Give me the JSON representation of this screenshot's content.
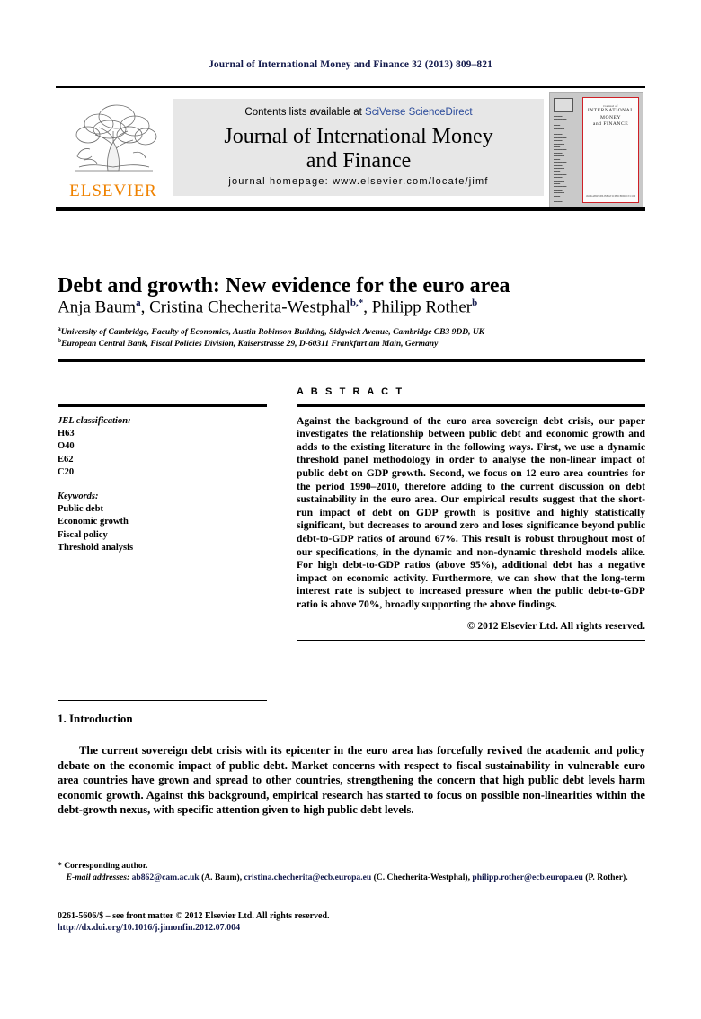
{
  "running_head": "Journal of International Money and Finance 32 (2013) 809–821",
  "masthead": {
    "contents_prefix": "Contents lists available at ",
    "sciencedirect": "SciVerse ScienceDirect",
    "journal_name_line1": "Journal of International Money",
    "journal_name_line2": "and Finance",
    "homepage": "journal homepage: www.elsevier.com/locate/jimf",
    "publisher_wordmark": "ELSEVIER",
    "publisher_color": "#ef8200",
    "band_background": "#e7e7e7"
  },
  "cover": {
    "line_small": "Journal of",
    "line1": "INTERNATIONAL",
    "line2": "MONEY",
    "line3": "and FINANCE",
    "footer": "AVAILABLE ONLINE AT SCIENCEDIRECT.COM",
    "border_color": "#cf2027",
    "background": "#c9c9c9"
  },
  "article": {
    "title": "Debt and growth: New evidence for the euro area",
    "authors": [
      {
        "name": "Anja Baum",
        "marks": "a"
      },
      {
        "name": "Cristina Checherita-Westphal",
        "marks": "b,*"
      },
      {
        "name": "Philipp Rother",
        "marks": "b"
      }
    ],
    "affiliations": [
      {
        "mark": "a",
        "text": "University of Cambridge, Faculty of Economics, Austin Robinson Building, Sidgwick Avenue, Cambridge CB3 9DD, UK"
      },
      {
        "mark": "b",
        "text": "European Central Bank, Fiscal Policies Division, Kaiserstrasse 29, D-60311 Frankfurt am Main, Germany"
      }
    ]
  },
  "info": {
    "jel_label": "JEL classification:",
    "jel_codes": [
      "H63",
      "O40",
      "E62",
      "C20"
    ],
    "keywords_label": "Keywords:",
    "keywords": [
      "Public debt",
      "Economic growth",
      "Fiscal policy",
      "Threshold analysis"
    ]
  },
  "abstract": {
    "heading": "A B S T R A C T",
    "text": "Against the background of the euro area sovereign debt crisis, our paper investigates the relationship between public debt and economic growth and adds to the existing literature in the following ways. First, we use a dynamic threshold panel methodology in order to analyse the non-linear impact of public debt on GDP growth. Second, we focus on 12 euro area countries for the period 1990–2010, therefore adding to the current discussion on debt sustainability in the euro area. Our empirical results suggest that the short-run impact of debt on GDP growth is positive and highly statistically significant, but decreases to around zero and loses significance beyond public debt-to-GDP ratios of around 67%. This result is robust throughout most of our specifications, in the dynamic and non-dynamic threshold models alike. For high debt-to-GDP ratios (above 95%), additional debt has a negative impact on economic activity. Furthermore, we can show that the long-term interest rate is subject to increased pressure when the public debt-to-GDP ratio is above 70%, broadly supporting the above findings.",
    "copyright": "© 2012 Elsevier Ltd. All rights reserved."
  },
  "introduction": {
    "heading": "1. Introduction",
    "paragraph": "The current sovereign debt crisis with its epicenter in the euro area has forcefully revived the academic and policy debate on the economic impact of public debt. Market concerns with respect to fiscal sustainability in vulnerable euro area countries have grown and spread to other countries, strengthening the concern that high public debt levels harm economic growth. Against this background, empirical research has started to focus on possible non-linearities within the debt-growth nexus, with specific attention given to high public debt levels."
  },
  "footnotes": {
    "corresponding": "* Corresponding author.",
    "email_label": "E-mail addresses:",
    "emails": [
      {
        "address": "ab862@cam.ac.uk",
        "owner": "(A. Baum)"
      },
      {
        "address": "cristina.checherita@ecb.europa.eu",
        "owner": "(C. Checherita-Westphal)"
      },
      {
        "address": "philipp.rother@ecb.europa.eu",
        "owner": "(P. Rother)"
      }
    ],
    "link_color": "#141b4d"
  },
  "imprint": {
    "issn_line": "0261-5606/$ – see front matter © 2012 Elsevier Ltd. All rights reserved.",
    "doi_line": "http://dx.doi.org/10.1016/j.jimonfin.2012.07.004"
  }
}
